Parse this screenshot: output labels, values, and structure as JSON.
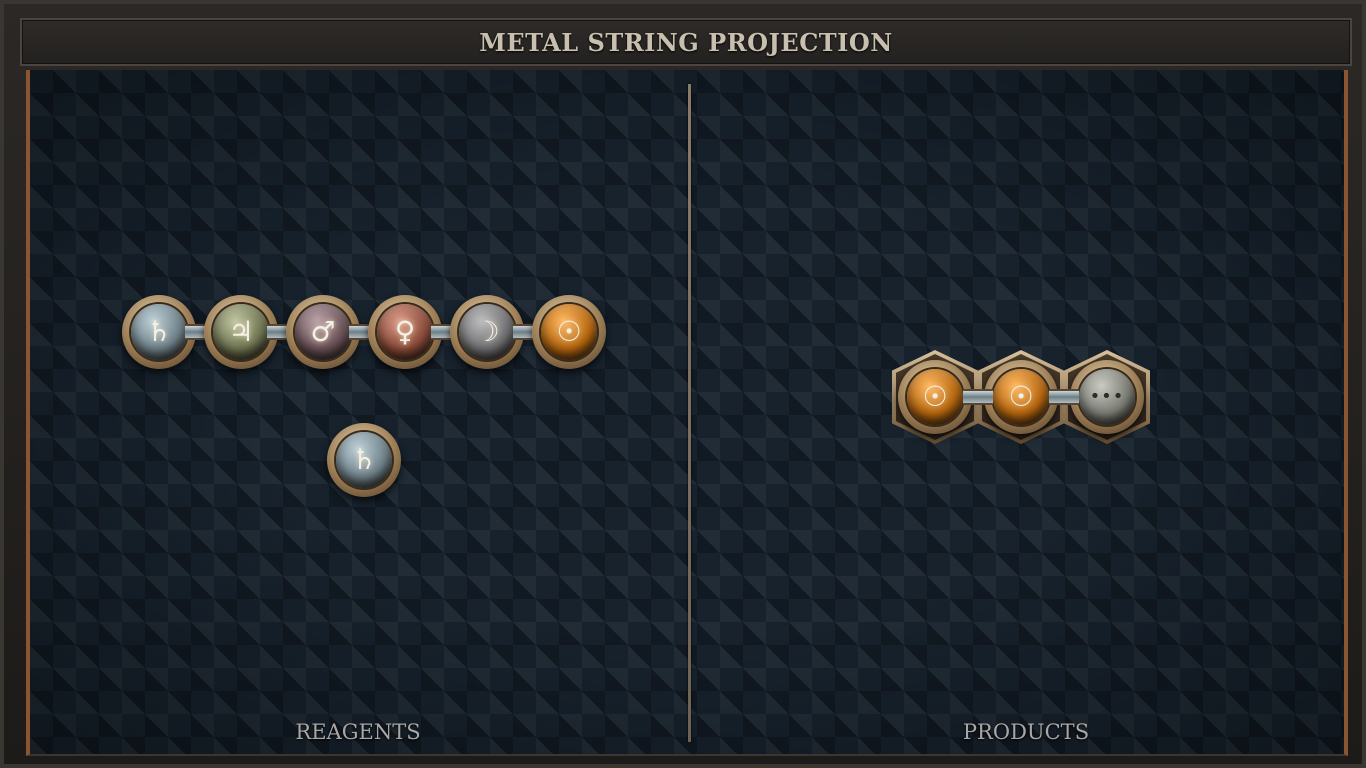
{
  "title": "METAL STRING PROJECTION",
  "panels": {
    "reagents_label": "REAGENTS",
    "products_label": "PRODUCTS"
  },
  "reagents": {
    "chain": [
      {
        "element": "lead",
        "symbol": "♄",
        "color": "#6e8088"
      },
      {
        "element": "tin",
        "symbol": "♃",
        "color": "#6f7451"
      },
      {
        "element": "iron",
        "symbol": "♂",
        "color": "#6a5257"
      },
      {
        "element": "copper",
        "symbol": "♀",
        "color": "#8a4a38"
      },
      {
        "element": "silver",
        "symbol": "☽",
        "color": "#6e6e70"
      },
      {
        "element": "gold",
        "symbol": "☉",
        "color": "#b5660e"
      }
    ],
    "single": {
      "element": "lead",
      "symbol": "♄",
      "color": "#6e8088"
    }
  },
  "products": {
    "chain": [
      {
        "element": "gold",
        "symbol": "☉",
        "color": "#b5660e"
      },
      {
        "element": "gold",
        "symbol": "☉",
        "color": "#b5660e"
      },
      {
        "element": "unknown",
        "symbol": "•••",
        "color": "#7a7c74"
      }
    ]
  }
}
